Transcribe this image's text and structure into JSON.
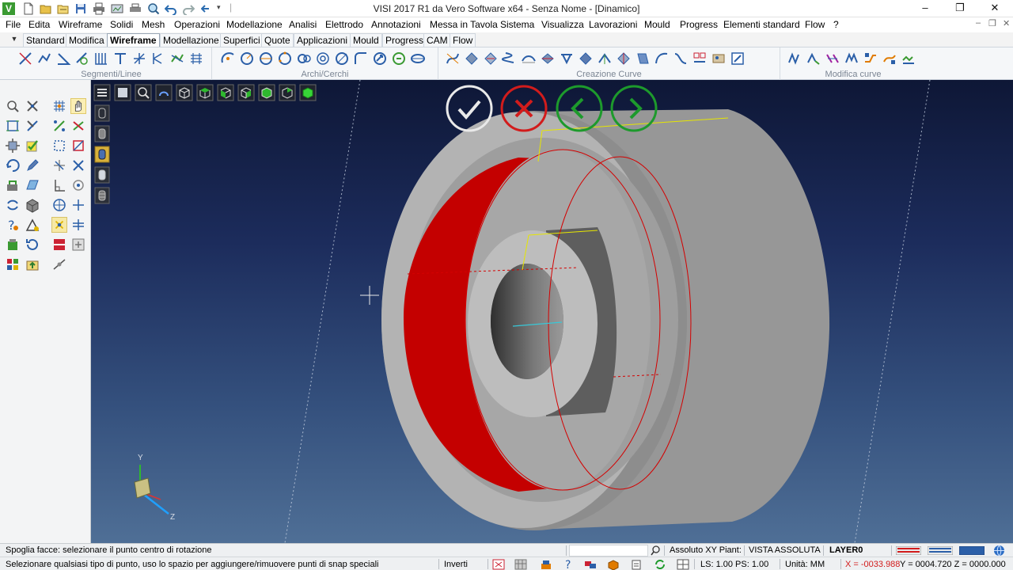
{
  "window": {
    "title": "VISI 2017 R1   da Vero Software x64 - Senza Nome - [Dinamico]",
    "app_icon_letter": "V",
    "minimize": "–",
    "restore": "❐",
    "close": "✕"
  },
  "menu": [
    "File",
    "Edita",
    "Wireframe",
    "Solidi",
    "Mesh",
    "Operazioni",
    "Modellazione",
    "Analisi",
    "Elettrodo",
    "Annotazioni",
    "Messa in Tavola",
    "Sistema",
    "Visualizza",
    "Lavorazioni",
    "Mould",
    "Progress",
    "Elementi standard",
    "Flow",
    "?"
  ],
  "mdi_controls": [
    "–",
    "❐",
    "✕"
  ],
  "tabs": {
    "items": [
      "Standard",
      "Modifica",
      "Wireframe",
      "Modellazione",
      "Superfici",
      "Quote",
      "Applicazioni",
      "Mould",
      "Progress",
      "CAM",
      "Flow"
    ],
    "active": "Wireframe",
    "dropdown": "▼"
  },
  "ribbon": {
    "groups": [
      "Segmenti/Linee",
      "Archi/Cerchi",
      "Creazione Curve",
      "Modifica curve"
    ]
  },
  "viewport": {
    "axis_labels": {
      "y": "Y",
      "z": "Z"
    },
    "dialog_buttons": [
      "confirm",
      "cancel",
      "previous",
      "next"
    ],
    "highlight_color": "#c40000",
    "model_color": "#a9a9a9"
  },
  "status": {
    "prompt": "Spoglia facce: selezionare il punto centro di rotazione",
    "hint": "Selezionare qualsiasi tipo di punto, uso lo spazio per aggiungere/rimuovere punti di snap speciali",
    "search_placeholder": "",
    "coord_mode": "Assoluto XY Piant:",
    "view": "VISTA ASSOLUTA",
    "layer": "LAYER0",
    "invert": "Inverti",
    "scale": "LS: 1.00 PS: 1.00",
    "units": "Unità: MM",
    "coord_x": "X = -0033.988",
    "coord_yz": "Y = 0004.720 Z = 0000.000"
  }
}
